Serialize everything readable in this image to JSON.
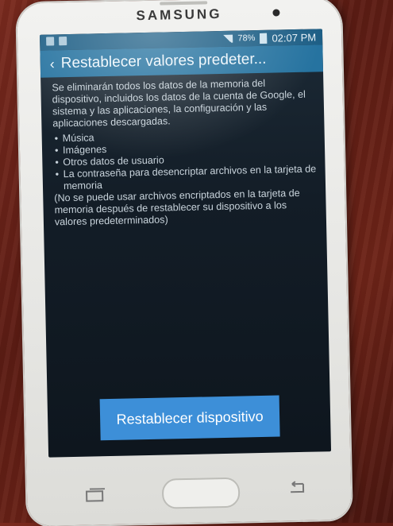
{
  "device": {
    "brand": "SAMSUNG"
  },
  "status_bar": {
    "battery": "78%",
    "time": "02:07 PM"
  },
  "action_bar": {
    "title": "Restablecer valores predeter..."
  },
  "content": {
    "intro": "Se eliminarán todos los datos de la memoria del dispositivo, incluidos los datos de la cuenta de Google, el sistema y las aplicaciones, la configuración y las aplicaciones descargadas.",
    "items": [
      "Música",
      "Imágenes",
      "Otros datos de usuario",
      "La contraseña para desencriptar archivos en la tarjeta de memoria"
    ],
    "note": "(No se puede usar archivos encriptados en la tarjeta de memoria después de restablecer su dispositivo a los valores predeterminados)"
  },
  "button": {
    "label": "Restablecer dispositivo"
  },
  "colors": {
    "action_bar": "#2673a0",
    "button": "#3d8fd8",
    "status_bar": "#1e5f86"
  }
}
